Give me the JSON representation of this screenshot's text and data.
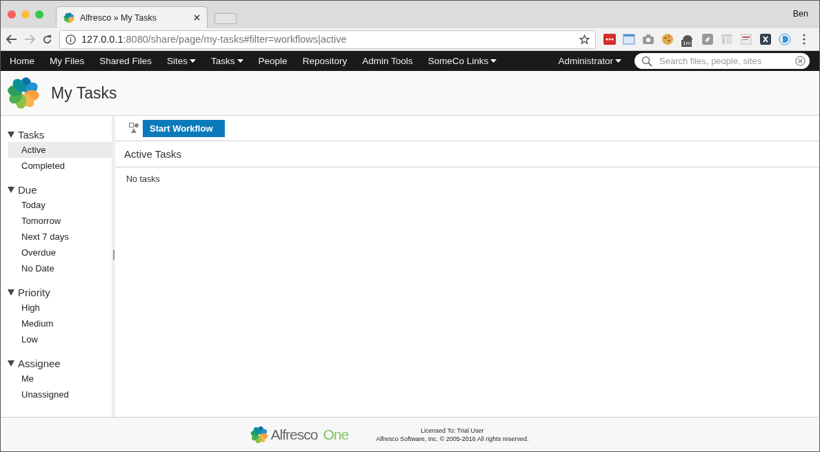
{
  "browser": {
    "tab_title": "Alfresco » My Tasks",
    "profile": "Ben",
    "url_host": "127.0.0.1",
    "url_path": ":8080/share/page/my-tasks#filter=workflows|active",
    "extension_badge": "1m"
  },
  "nav": {
    "items": [
      {
        "label": "Home",
        "dropdown": false
      },
      {
        "label": "My Files",
        "dropdown": false
      },
      {
        "label": "Shared Files",
        "dropdown": false
      },
      {
        "label": "Sites",
        "dropdown": true
      },
      {
        "label": "Tasks",
        "dropdown": true
      },
      {
        "label": "People",
        "dropdown": false
      },
      {
        "label": "Repository",
        "dropdown": false
      },
      {
        "label": "Admin Tools",
        "dropdown": false
      },
      {
        "label": "SomeCo Links",
        "dropdown": true
      }
    ],
    "user": {
      "label": "Administrator",
      "dropdown": true
    },
    "search": {
      "placeholder": "Search files, people, sites"
    }
  },
  "header": {
    "title": "My Tasks"
  },
  "sidebar": {
    "groups": [
      {
        "title": "Tasks",
        "expanded": true,
        "items": [
          {
            "label": "Active",
            "selected": true
          },
          {
            "label": "Completed",
            "selected": false
          }
        ]
      },
      {
        "title": "Due",
        "expanded": true,
        "items": [
          {
            "label": "Today",
            "selected": false
          },
          {
            "label": "Tomorrow",
            "selected": false
          },
          {
            "label": "Next 7 days",
            "selected": false
          },
          {
            "label": "Overdue",
            "selected": false
          },
          {
            "label": "No Date",
            "selected": false
          }
        ]
      },
      {
        "title": "Priority",
        "expanded": true,
        "items": [
          {
            "label": "High",
            "selected": false
          },
          {
            "label": "Medium",
            "selected": false
          },
          {
            "label": "Low",
            "selected": false
          }
        ]
      },
      {
        "title": "Assignee",
        "expanded": true,
        "items": [
          {
            "label": "Me",
            "selected": false
          },
          {
            "label": "Unassigned",
            "selected": false
          }
        ]
      }
    ]
  },
  "toolbar": {
    "button": "Start Workflow"
  },
  "list": {
    "title": "Active Tasks",
    "empty_message": "No tasks"
  },
  "footer": {
    "logo_word": "Alfresco",
    "logo_suffix": "One",
    "license": "Licensed To: Trial User",
    "copyright": "Alfresco Software, Inc. © 2005-2016 All rights reserved."
  }
}
